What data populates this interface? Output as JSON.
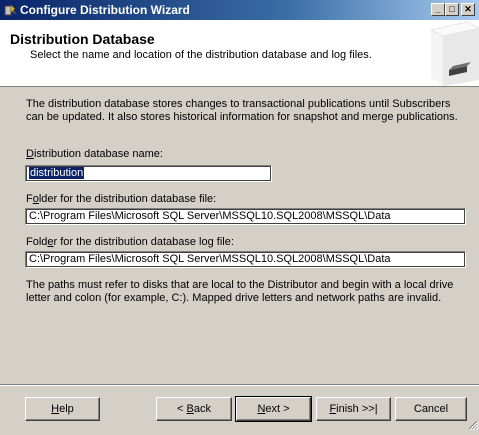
{
  "window": {
    "title": "Configure Distribution Wizard",
    "controls": {
      "minimize": "_",
      "maximize": "□",
      "close": "✕"
    }
  },
  "header": {
    "title": "Distribution Database",
    "subtitle": "Select the name and location of the distribution database and log files."
  },
  "intro_text": "The distribution database stores changes to transactional publications until Subscribers can be updated. It also stores historical information for snapshot and merge publications.",
  "fields": {
    "db_name": {
      "label_pre": "",
      "label_key": "D",
      "label_post": "istribution database name:",
      "value": "distribution"
    },
    "db_folder": {
      "label_pre": "F",
      "label_key": "o",
      "label_post": "lder for the distribution database file:",
      "value": "C:\\Program Files\\Microsoft SQL Server\\MSSQL10.SQL2008\\MSSQL\\Data"
    },
    "log_folder": {
      "label_pre": "Fold",
      "label_key": "e",
      "label_post": "r for the distribution database log file:",
      "value": "C:\\Program Files\\Microsoft SQL Server\\MSSQL10.SQL2008\\MSSQL\\Data"
    }
  },
  "note_text": "The paths must refer to disks that are local to the Distributor and begin with a local drive letter and colon (for example, C:). Mapped drive letters and network paths are invalid.",
  "buttons": {
    "help": {
      "pre": "",
      "key": "H",
      "post": "elp"
    },
    "back": {
      "pre": "< ",
      "key": "B",
      "post": "ack"
    },
    "next": {
      "pre": "",
      "key": "N",
      "post": "ext >"
    },
    "finish": {
      "pre": "",
      "key": "F",
      "post": "inish >>|"
    },
    "cancel": {
      "pre": "Cancel",
      "key": "",
      "post": ""
    }
  },
  "colors": {
    "title_bar_start": "#0a246a",
    "title_bar_end": "#a6caf0",
    "dialog_bg": "#d4d0c8",
    "selection": "#0a246a"
  },
  "icons": {
    "app": "wizard-app-icon",
    "header_graphic": "server-box-graphic"
  }
}
